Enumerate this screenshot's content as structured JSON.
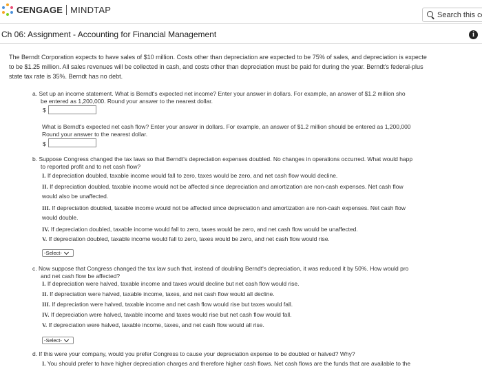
{
  "header": {
    "brand": "CENGAGE",
    "product": "MINDTAP",
    "search_placeholder": "Search this co"
  },
  "assignment": {
    "title": "Ch 06: Assignment - Accounting for Financial Management",
    "info_glyph": "i"
  },
  "intro": [
    "The Berndt Corporation expects to have sales of $10 million. Costs other than depreciation are expected to be 75% of sales, and depreciation is expecte",
    "to be $1.25 million. All sales revenues will be collected in cash, and costs other than depreciation must be paid for during the year. Berndt's federal-plus",
    "state tax rate is 35%. Berndt has no debt."
  ],
  "part_a": {
    "q1": [
      "a. Set up an income statement. What is Berndt's expected net income? Enter your answer in dollars. For example, an answer of $1.2 million sho",
      "be entered as 1,200,000. Round your answer to the nearest dollar."
    ],
    "q2": [
      "What is Berndt's expected net cash flow? Enter your answer in dollars. For example, an answer of $1.2 million should be entered as 1,200,000",
      "Round your answer to the nearest dollar."
    ],
    "dollar": "$",
    "answer1": "",
    "answer2": ""
  },
  "part_b": {
    "question": [
      "b. Suppose Congress changed the tax laws so that Berndt's depreciation expenses doubled. No changes in operations occurred. What would happ",
      "to reported profit and to net cash flow?"
    ],
    "options": [
      {
        "num": "I.",
        "text": "If depreciation doubled, taxable income would fall to zero, taxes would be zero, and net cash flow would decline."
      },
      {
        "num": "II.",
        "text": "If depreciation doubled, taxable income would not be affected since depreciation and amortization are non-cash expenses. Net cash flow",
        "cont": "would also be unaffected."
      },
      {
        "num": "III.",
        "text": "If depreciation doubled, taxable income would not be affected since depreciation and amortization are non-cash expenses. Net cash flow",
        "cont": "would double."
      },
      {
        "num": "IV.",
        "text": "If depreciation doubled, taxable income would fall to zero, taxes would be zero, and net cash flow would be unaffected."
      },
      {
        "num": "V.",
        "text": "If depreciation doubled, taxable income would fall to zero, taxes would be zero, and net cash flow would rise."
      }
    ],
    "select_label": "-Select-"
  },
  "part_c": {
    "question": [
      "c. Now suppose that Congress changed the tax law such that, instead of doubling Berndt's depreciation, it was reduced it by 50%. How would pro",
      "and net cash flow be affected?"
    ],
    "options": [
      {
        "num": "I.",
        "text": "If depreciation were halved, taxable income and taxes would decline but net cash flow would rise."
      },
      {
        "num": "II.",
        "text": "If depreciation were halved, taxable income, taxes, and net cash flow would all decline."
      },
      {
        "num": "III.",
        "text": "If depreciation were halved, taxable income and net cash flow would rise but taxes would fall."
      },
      {
        "num": "IV.",
        "text": "If depreciation were halved, taxable income and taxes would rise but net cash flow would fall."
      },
      {
        "num": "V.",
        "text": "If depreciation were halved, taxable income, taxes, and net cash flow would all rise."
      }
    ],
    "select_label": "-Select-"
  },
  "part_d": {
    "question": "d. If this were your company, would you prefer Congress to cause your depreciation expense to be doubled or halved? Why?",
    "option1": {
      "num": "I.",
      "text": "You should prefer to have higher depreciation charges and therefore higher cash flows. Net cash flows are the funds that are available to the"
    }
  },
  "colors": {
    "logo_dots": [
      "#f5a623",
      "#e94e77",
      "#4a90d9",
      "#7ed321"
    ],
    "border": "#d6d6d6"
  }
}
